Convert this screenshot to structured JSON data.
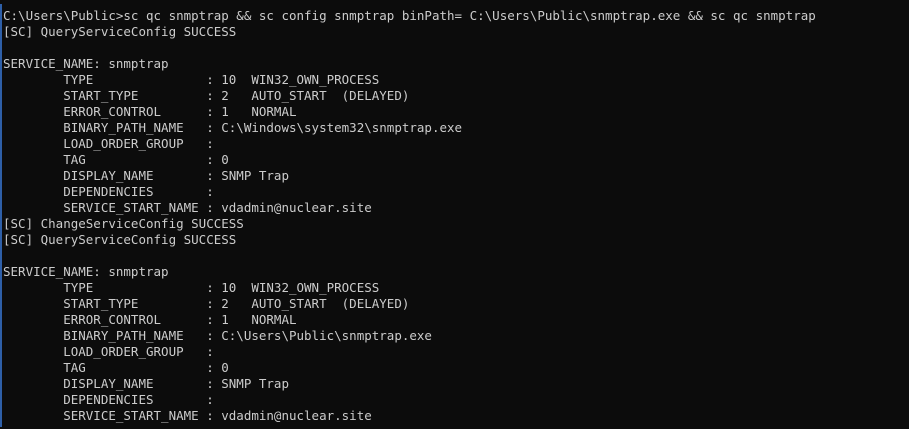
{
  "console": {
    "lines": [
      "C:\\Users\\Public>sc qc snmptrap && sc config snmptrap binPath= C:\\Users\\Public\\snmptrap.exe && sc qc snmptrap",
      "[SC] QueryServiceConfig SUCCESS",
      "",
      "SERVICE_NAME: snmptrap",
      "        TYPE               : 10  WIN32_OWN_PROCESS",
      "        START_TYPE         : 2   AUTO_START  (DELAYED)",
      "        ERROR_CONTROL      : 1   NORMAL",
      "        BINARY_PATH_NAME   : C:\\Windows\\system32\\snmptrap.exe",
      "        LOAD_ORDER_GROUP   :",
      "        TAG                : 0",
      "        DISPLAY_NAME       : SNMP Trap",
      "        DEPENDENCIES       :",
      "        SERVICE_START_NAME : vdadmin@nuclear.site",
      "[SC] ChangeServiceConfig SUCCESS",
      "[SC] QueryServiceConfig SUCCESS",
      "",
      "SERVICE_NAME: snmptrap",
      "        TYPE               : 10  WIN32_OWN_PROCESS",
      "        START_TYPE         : 2   AUTO_START  (DELAYED)",
      "        ERROR_CONTROL      : 1   NORMAL",
      "        BINARY_PATH_NAME   : C:\\Users\\Public\\snmptrap.exe",
      "        LOAD_ORDER_GROUP   :",
      "        TAG                : 0",
      "        DISPLAY_NAME       : SNMP Trap",
      "        DEPENDENCIES       :",
      "        SERVICE_START_NAME : vdadmin@nuclear.site"
    ]
  },
  "colors": {
    "background": "#0c0c0c",
    "text": "#cccccc",
    "accent_bar": "#2e5fa8"
  }
}
